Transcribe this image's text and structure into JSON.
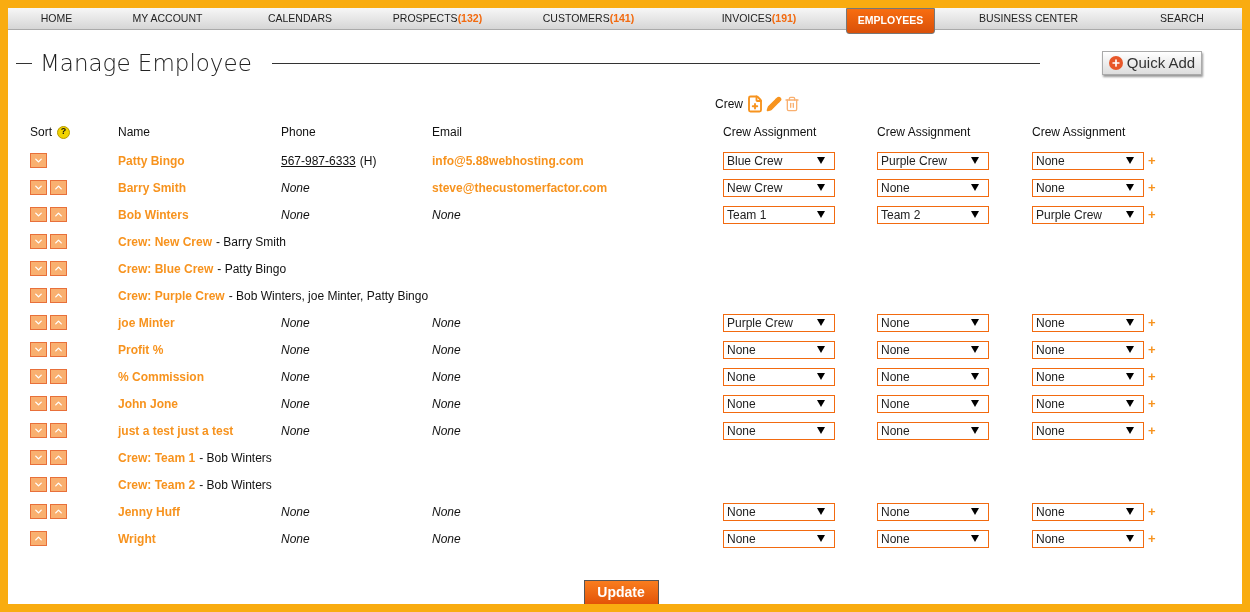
{
  "nav": [
    {
      "label": "HOME",
      "selected": false
    },
    {
      "label": "MY ACCOUNT",
      "selected": false
    },
    {
      "label": "CALENDARS",
      "selected": false
    },
    {
      "label": "PROSPECTS",
      "count": "(132)",
      "selected": false
    },
    {
      "label": "CUSTOMERS",
      "count": "(141)",
      "selected": false
    },
    {
      "label": "INVOICES",
      "count": "(191)",
      "selected": false
    },
    {
      "label": "EMPLOYEES",
      "selected": true
    },
    {
      "label": "BUSINESS CENTER",
      "selected": false
    },
    {
      "label": "SEARCH",
      "selected": false
    }
  ],
  "title": "Manage Employee",
  "quick_add": "Quick Add",
  "crew_label": "Crew",
  "columns": {
    "sort": "Sort",
    "help": "?",
    "name": "Name",
    "phone": "Phone",
    "email": "Email",
    "crew": [
      "Crew Assignment",
      "Crew Assignment",
      "Crew Assignment"
    ]
  },
  "rows": [
    {
      "kind": "employee",
      "down": true,
      "up": false,
      "name": "Patty Bingo",
      "phone": {
        "kind": "number",
        "text": "567-987-6333",
        "type": "(H)"
      },
      "email": {
        "kind": "link",
        "text": "info@5.88webhosting.com"
      },
      "crews": [
        "Blue Crew",
        "Purple Crew",
        "None"
      ],
      "add": "+"
    },
    {
      "kind": "employee",
      "down": true,
      "up": true,
      "name": "Barry Smith",
      "phone": {
        "kind": "none",
        "text": "None"
      },
      "email": {
        "kind": "link",
        "text": "steve@thecustomerfactor.com"
      },
      "crews": [
        "New Crew",
        "None",
        "None"
      ],
      "add": "+"
    },
    {
      "kind": "employee",
      "down": true,
      "up": true,
      "name": "Bob Winters",
      "phone": {
        "kind": "none",
        "text": "None"
      },
      "email": {
        "kind": "none",
        "text": "None"
      },
      "crews": [
        "Team 1",
        "Team 2",
        "Purple Crew"
      ],
      "add": "+"
    },
    {
      "kind": "crew",
      "down": true,
      "up": true,
      "name": "Crew: New Crew",
      "members": "- Barry Smith"
    },
    {
      "kind": "crew",
      "down": true,
      "up": true,
      "name": "Crew: Blue Crew",
      "members": "- Patty Bingo"
    },
    {
      "kind": "crew",
      "down": true,
      "up": true,
      "name": "Crew: Purple Crew",
      "members": "- Bob Winters, joe Minter, Patty Bingo"
    },
    {
      "kind": "employee",
      "down": true,
      "up": true,
      "name": "joe Minter",
      "phone": {
        "kind": "none",
        "text": "None"
      },
      "email": {
        "kind": "none",
        "text": "None"
      },
      "crews": [
        "Purple Crew",
        "None",
        "None"
      ],
      "add": "+"
    },
    {
      "kind": "employee",
      "down": true,
      "up": true,
      "name": "Profit %",
      "phone": {
        "kind": "none",
        "text": "None"
      },
      "email": {
        "kind": "none",
        "text": "None"
      },
      "crews": [
        "None",
        "None",
        "None"
      ],
      "add": "+"
    },
    {
      "kind": "employee",
      "down": true,
      "up": true,
      "name": "% Commission",
      "phone": {
        "kind": "none",
        "text": "None"
      },
      "email": {
        "kind": "none",
        "text": "None"
      },
      "crews": [
        "None",
        "None",
        "None"
      ],
      "add": "+"
    },
    {
      "kind": "employee",
      "down": true,
      "up": true,
      "name": "John Jone",
      "phone": {
        "kind": "none",
        "text": "None"
      },
      "email": {
        "kind": "none",
        "text": "None"
      },
      "crews": [
        "None",
        "None",
        "None"
      ],
      "add": "+"
    },
    {
      "kind": "employee",
      "down": true,
      "up": true,
      "name": "just a test just a test",
      "phone": {
        "kind": "none",
        "text": "None"
      },
      "email": {
        "kind": "none",
        "text": "None"
      },
      "crews": [
        "None",
        "None",
        "None"
      ],
      "add": "+"
    },
    {
      "kind": "crew",
      "down": true,
      "up": true,
      "name": "Crew: Team 1",
      "members": "- Bob Winters"
    },
    {
      "kind": "crew",
      "down": true,
      "up": true,
      "name": "Crew: Team 2",
      "members": "- Bob Winters"
    },
    {
      "kind": "employee",
      "down": true,
      "up": true,
      "name": "Jenny Huff",
      "phone": {
        "kind": "none",
        "text": "None"
      },
      "email": {
        "kind": "none",
        "text": "None"
      },
      "crews": [
        "None",
        "None",
        "None"
      ],
      "add": "+"
    },
    {
      "kind": "employee",
      "down": false,
      "up": true,
      "name": "Wright",
      "phone": {
        "kind": "none",
        "text": "None"
      },
      "email": {
        "kind": "none",
        "text": "None"
      },
      "crews": [
        "None",
        "None",
        "None"
      ],
      "add": "+"
    }
  ],
  "update": "Update"
}
